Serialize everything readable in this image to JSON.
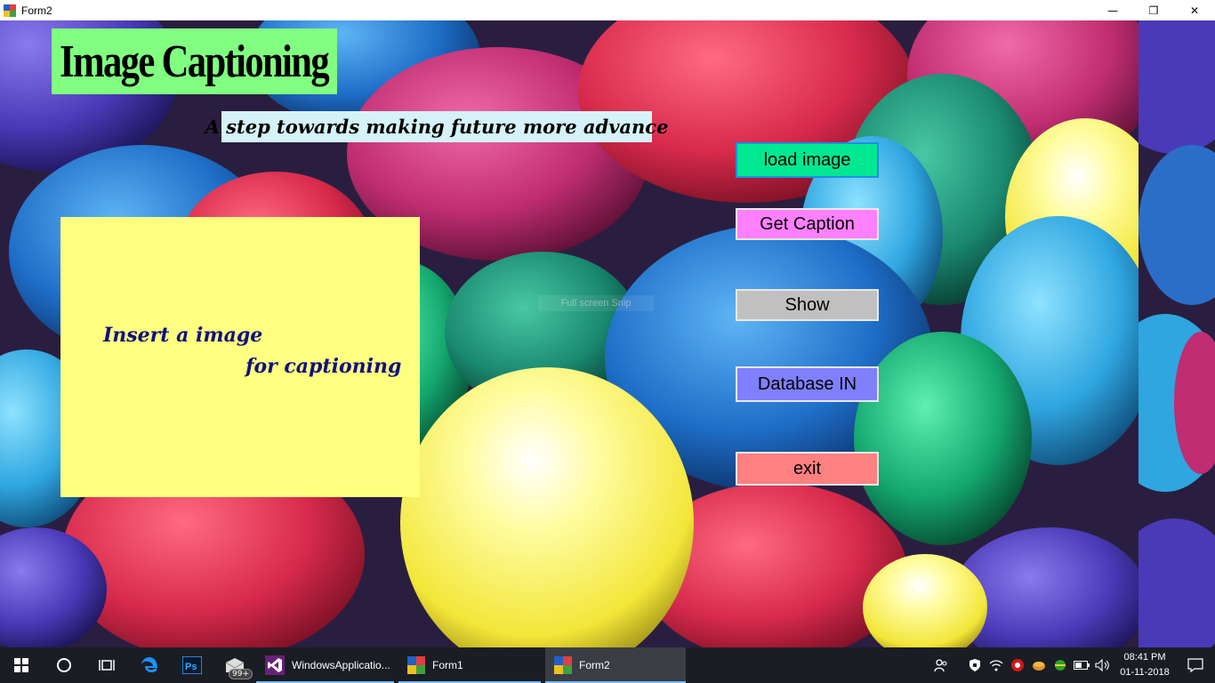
{
  "window": {
    "title": "Form2",
    "controls": {
      "minimize": "—",
      "maximize": "❐",
      "close": "✕"
    }
  },
  "header": {
    "title": "Image Captioning",
    "subtitle": "A step towards making future more advance"
  },
  "image_panel": {
    "placeholder_line1": "Insert a image",
    "placeholder_line2": "for captioning"
  },
  "buttons": {
    "load": "load image",
    "caption": "Get Caption",
    "show": "Show",
    "database": "Database IN",
    "exit": "exit"
  },
  "faint_label": "Full screen Snip",
  "taskbar": {
    "apps": [
      {
        "label": "WindowsApplicatio..."
      },
      {
        "label": "Form1"
      },
      {
        "label": "Form2"
      }
    ],
    "mail_badge": "99+",
    "clock": {
      "time": "08:41 PM",
      "date": "01-11-2018"
    }
  },
  "colors": {
    "title_bg": "#80ff80",
    "subtitle_bg": "#d4f2f7",
    "panel_bg": "#ffff80",
    "load_btn": "#00e891",
    "caption_btn": "#ff80ff",
    "show_btn": "#c0c0c0",
    "database_btn": "#8080ff",
    "exit_btn": "#ff8080",
    "taskbar": "#1b1d24"
  }
}
